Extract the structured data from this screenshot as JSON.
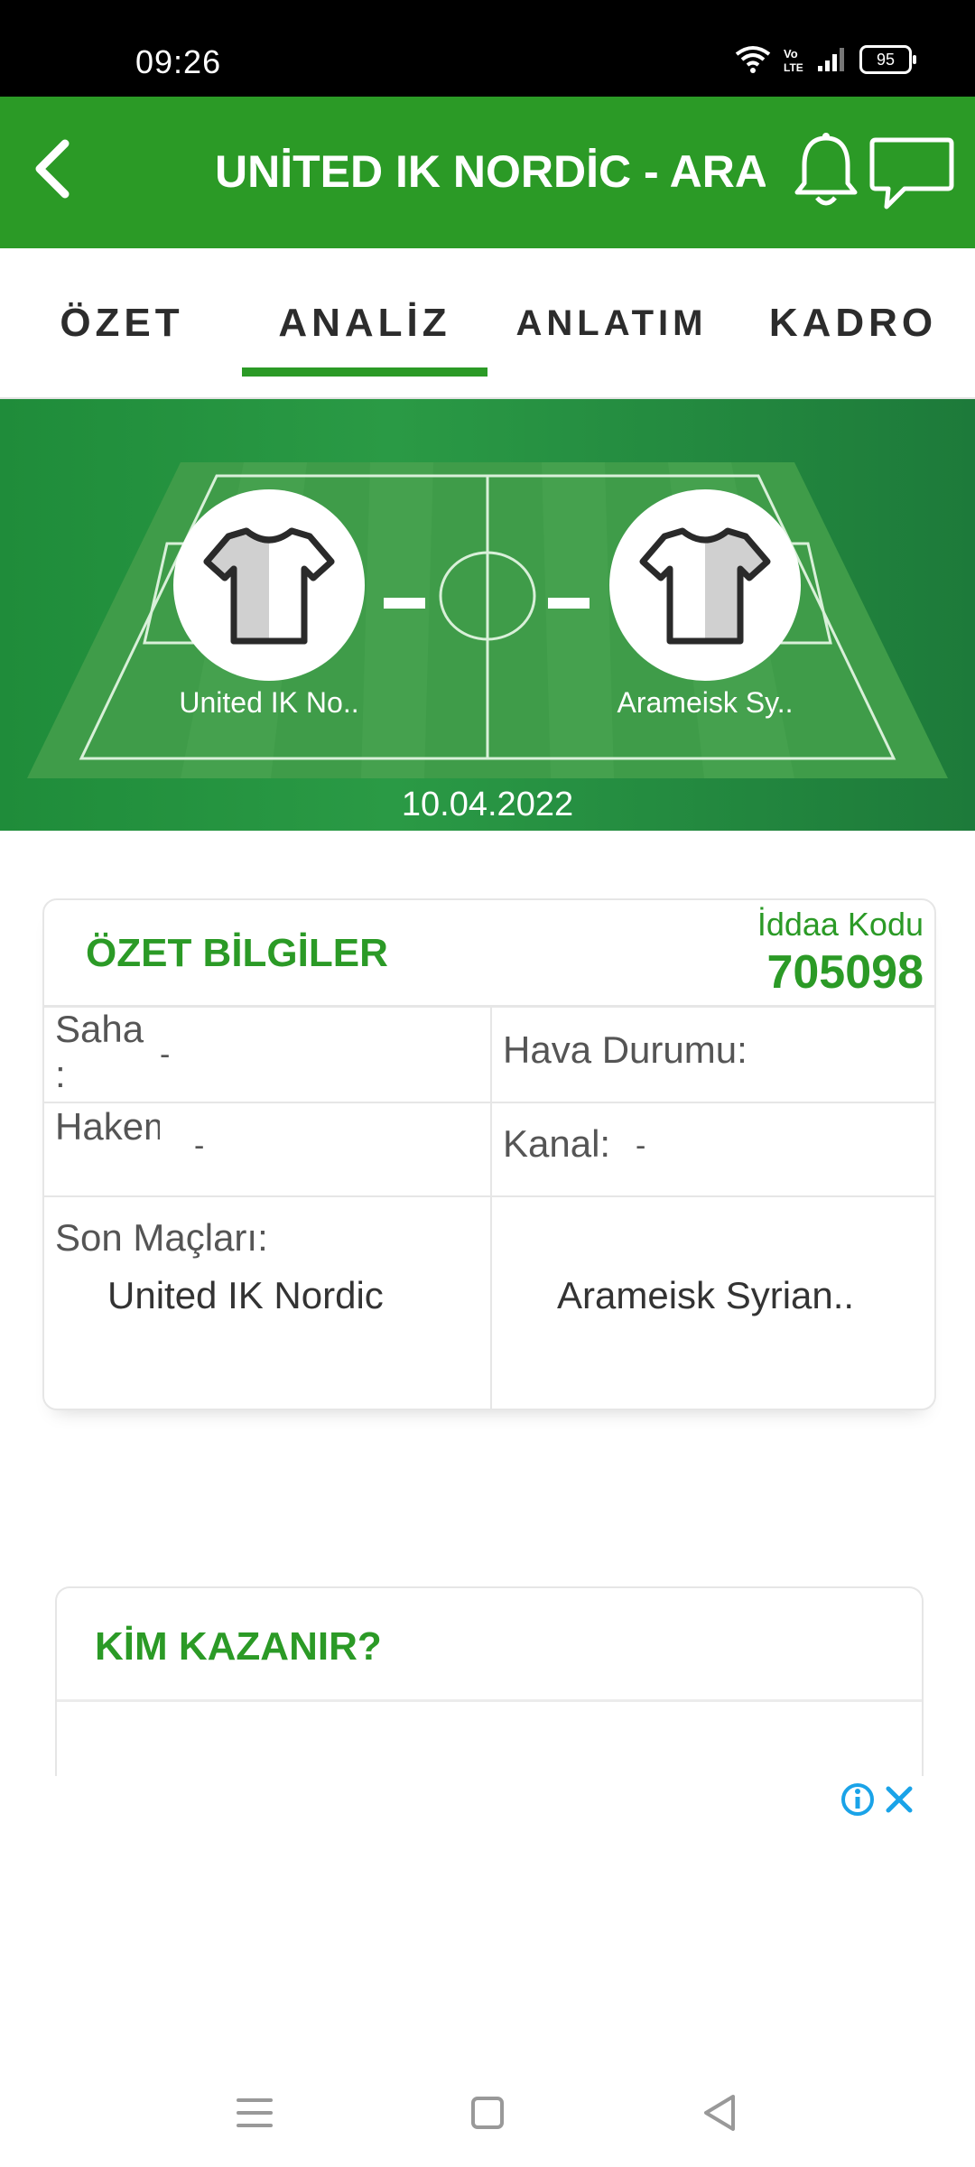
{
  "status_bar": {
    "time": "09:26",
    "battery": "95",
    "network": "VoLTE"
  },
  "app_bar": {
    "title": "UNİTED IK NORDİC - ARA..."
  },
  "tabs": [
    {
      "label": "ÖZET"
    },
    {
      "label": "ANALİZ"
    },
    {
      "label": "ANLATIM"
    },
    {
      "label": "KADRO"
    }
  ],
  "active_tab": "ANALİZ",
  "match": {
    "home_team": "United IK No..",
    "away_team": "Arameisk Sy..",
    "date": "10.04.2022"
  },
  "summary": {
    "title": "ÖZET BİLGİLER",
    "iddaa_label": "İddaa Kodu",
    "iddaa_code": "705098",
    "saha_label": "Saha :",
    "saha_value": "-",
    "hava_label": "Hava Durumu:",
    "hakem_label": "Hakem:",
    "hakem_value": "-",
    "kanal_label": "Kanal:",
    "kanal_value": "-",
    "son_maclari_label": "Son Maçları:",
    "home_full": "United IK Nordic",
    "away_full": "Arameisk Syrian.."
  },
  "who_wins": {
    "title": "KİM KAZANIR?"
  },
  "colors": {
    "brand_green": "#2b9a26",
    "ad_blue": "#1aa3e8"
  }
}
